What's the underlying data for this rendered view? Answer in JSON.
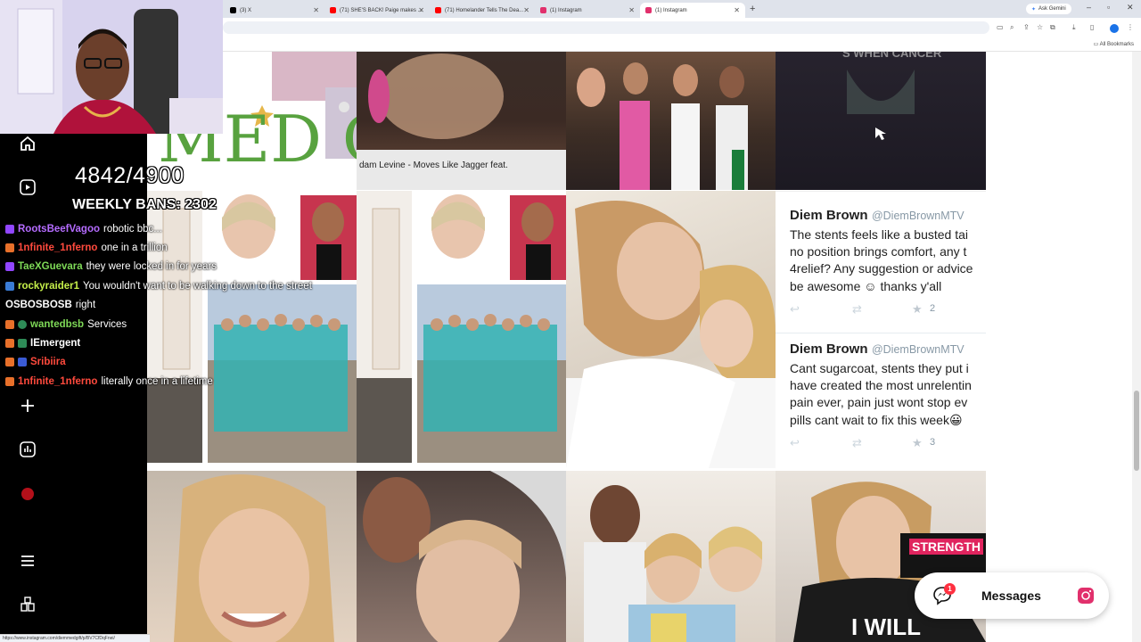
{
  "browser": {
    "tabs": [
      {
        "title": "(3) X",
        "active": false
      },
      {
        "title": "(71) SHE'S BACK! Paige makes ...",
        "active": false
      },
      {
        "title": "(71) Homelander Tells The Dea...",
        "active": false
      },
      {
        "title": "(1) Instagram",
        "active": false
      },
      {
        "title": "(1) Instagram",
        "active": true
      }
    ],
    "new_tab": "+",
    "ask_gemini": "Ask Gemini",
    "all_bookmarks": "All Bookmarks",
    "status_url": "https://www.instagram.com/diemmedgift/p/BV7CfDqFnei/"
  },
  "post_grid": {
    "medgift_text": "MED Gift",
    "caption_fragment": "dam Levine - Moves Like Jagger feat.",
    "ghost_text": "S WHEN CANCER",
    "tweets": [
      {
        "name": "Diem Brown",
        "handle": "@DiemBrownMTV",
        "lines": [
          "The stents feels like a busted tai",
          "no position brings comfort, any t",
          "4relief? Any suggestion or advice",
          "be awesome ☺ thanks y'all"
        ],
        "favorites": "2"
      },
      {
        "name": "Diem Brown",
        "handle": "@DiemBrownMTV",
        "lines": [
          "Cant sugarcoat, stents they put i",
          "have created the most unrelentin",
          "pain ever, pain just wont stop ev",
          "pills cant wait to fix this week😀"
        ],
        "favorites": "3"
      }
    ],
    "shirt_strength": "STRENGTH",
    "shirt_iwill": "I WILL"
  },
  "messages": {
    "label": "Messages",
    "count": "1"
  },
  "stream_overlay": {
    "goal_counter": "4842/4900",
    "weekly_bans": "WEEKLY BANS: 2302",
    "chat": [
      {
        "user": "RootsBeefVagoo",
        "text": "robotic bbc...",
        "color": "#b56cff"
      },
      {
        "user": "1nfinite_1nferno",
        "text": "one in a trillion",
        "color": "#ff4a3d"
      },
      {
        "user": "TaeXGuevara",
        "text": "they were locked in for years",
        "color": "#7ed957"
      },
      {
        "user": "rockyraider1",
        "text": "You wouldn't want to be walking down to the street",
        "color": "#c6f04a"
      },
      {
        "user": "OSBOSBOSB",
        "text": "right",
        "color": "#ffffff"
      },
      {
        "user": "wantedbsb",
        "text": "Services",
        "color": "#7ed957"
      },
      {
        "user": "IEmergent",
        "text": "",
        "color": "#ffffff"
      },
      {
        "user": "Sribiira",
        "text": "",
        "color": "#ff4a3d"
      },
      {
        "user": "1nfinite_1nferno",
        "text": "literally once in a lifetime",
        "color": "#ff4a3d"
      }
    ]
  }
}
